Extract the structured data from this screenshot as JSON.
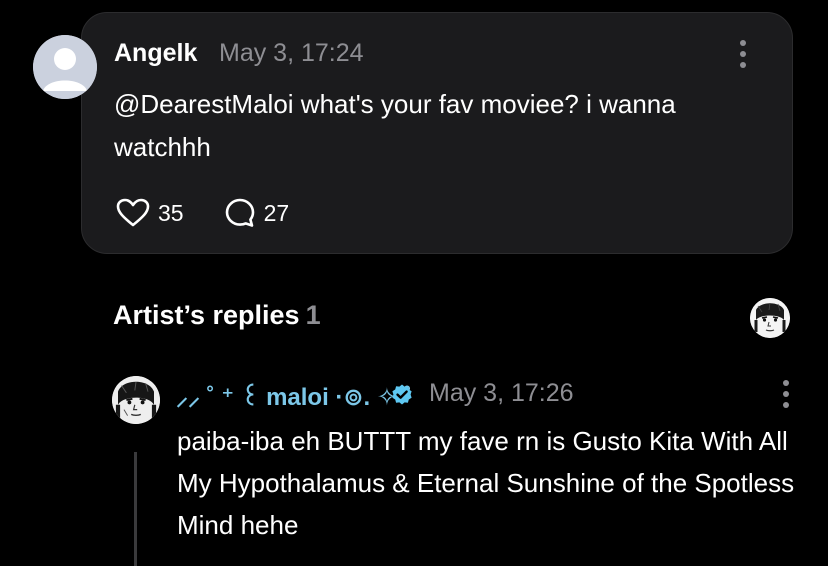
{
  "comment": {
    "username": "Angelk",
    "timestamp": "May 3, 17:24",
    "text": "@DearestMaloi what's your fav moviee? i wanna watchhh",
    "likes": "35",
    "replies": "27",
    "avatar_icon": "default-avatar-icon",
    "more_icon": "more-vertical-icon"
  },
  "artist_replies": {
    "title": "Artist’s replies",
    "count": "1"
  },
  "reply": {
    "username": "⸝⸝ ˚ ⁺ ꒰ maloi ·⊚. ✧ ˚",
    "verified_icon": "verified-badge-icon",
    "timestamp": "May 3, 17:26",
    "text": "paiba-iba eh BUTTT my fave rn is Gusto Kita With All My Hypothalamus & Eternal Sunshine of the Spotless Mind hehe"
  },
  "colors": {
    "background": "#000000",
    "card": "#1b1b1d",
    "muted_text": "#8e8e93",
    "artist_name": "#7cc7e8",
    "verified": "#5ec8f2"
  }
}
